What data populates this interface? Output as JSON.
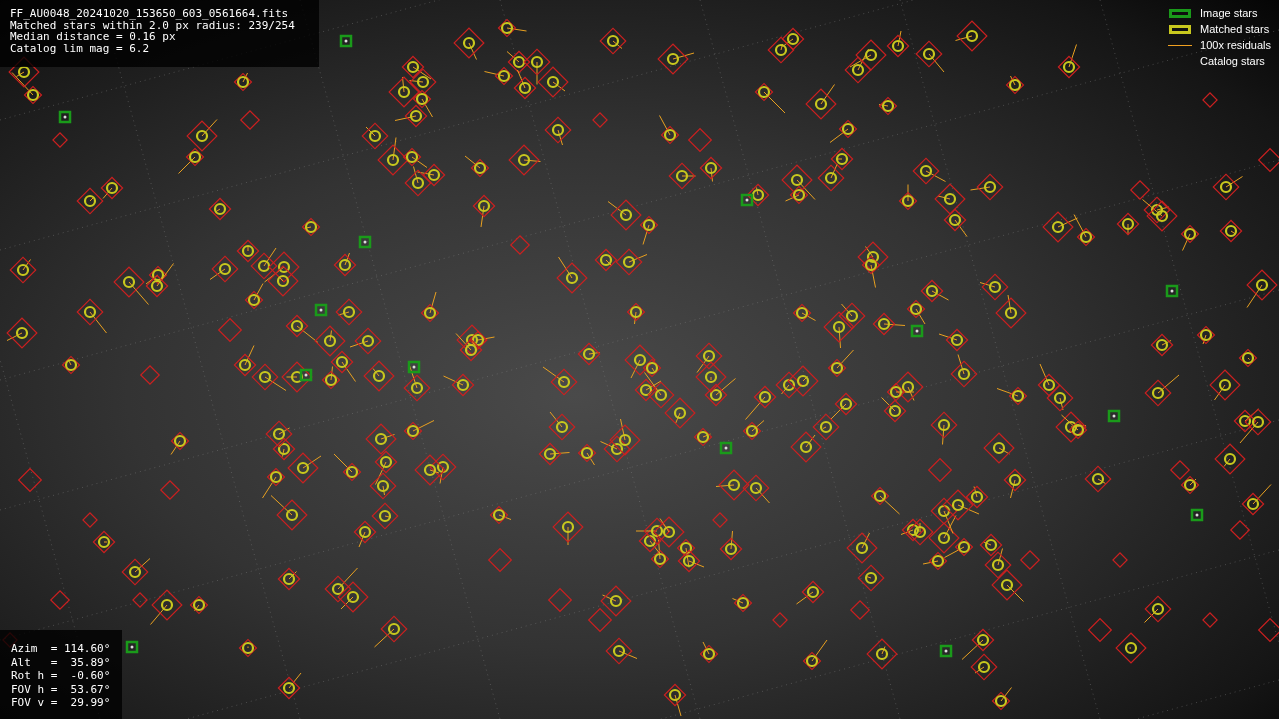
{
  "info_box": {
    "lines": [
      "FF_AU0048_20241020_153650_603_0561664.fits",
      "Matched stars within 2.0 px radius: 239/254",
      "Median distance = 0.16 px",
      "Catalog lim mag = 6.2"
    ]
  },
  "legend": [
    {
      "kind": "box",
      "label": "Image stars",
      "color": "#1a9a1a"
    },
    {
      "kind": "box",
      "label": "Matched stars",
      "color": "#c8c81e"
    },
    {
      "kind": "line",
      "label": "100x residuals",
      "color": "#f0a020"
    },
    {
      "kind": "none",
      "label": "Catalog stars"
    }
  ],
  "pointing_box": {
    "lines": [
      "Azim  = 114.60°",
      "Alt   =  35.89°",
      "Rot h =  -0.60°",
      "FOV h =  53.67°",
      "FOV v =  29.99°"
    ]
  }
}
